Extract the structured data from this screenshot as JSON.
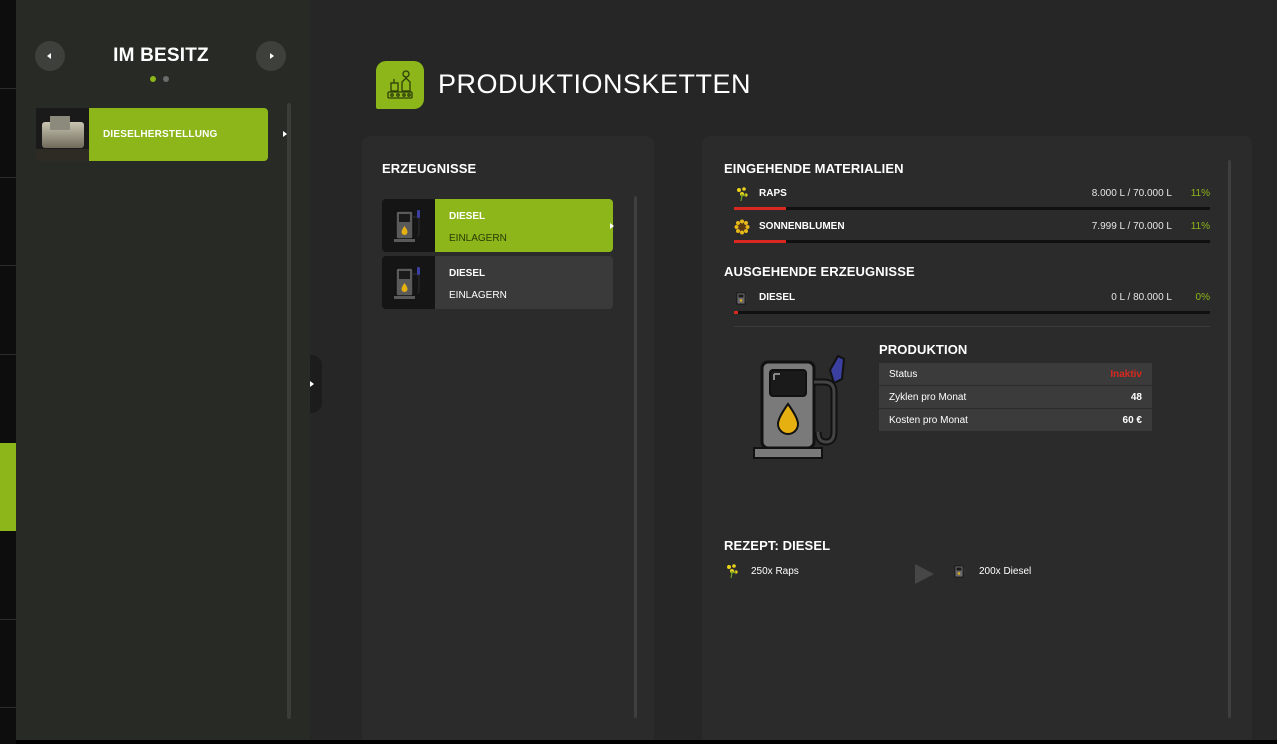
{
  "sidebar": {
    "title": "IM BESITZ",
    "page_dots": 2,
    "active_dot": 0,
    "items": [
      {
        "label": "DIESELHERSTELLUNG",
        "selected": true
      }
    ]
  },
  "main": {
    "title": "PRODUKTIONSKETTEN",
    "products_panel": {
      "heading": "ERZEUGNISSE",
      "items": [
        {
          "name": "DIESEL",
          "mode": "EINLAGERN",
          "selected": true
        },
        {
          "name": "DIESEL",
          "mode": "EINLAGERN",
          "selected": false
        }
      ]
    },
    "details": {
      "incoming_heading": "EINGEHENDE MATERIALIEN",
      "incoming": [
        {
          "name": "RAPS",
          "icon": "rapeseed-icon",
          "amount": "8.000 L / 70.000 L",
          "percent": "11%",
          "fill": 0.11
        },
        {
          "name": "SONNENBLUMEN",
          "icon": "sunflower-icon",
          "amount": "7.999 L / 70.000 L",
          "percent": "11%",
          "fill": 0.11
        }
      ],
      "outgoing_heading": "AUSGEHENDE ERZEUGNISSE",
      "outgoing": [
        {
          "name": "DIESEL",
          "icon": "fuel-pump-icon",
          "amount": "0 L / 80.000 L",
          "percent": "0%",
          "fill": 0.0
        }
      ],
      "production": {
        "heading": "PRODUKTION",
        "rows": [
          {
            "label": "Status",
            "value": "Inaktiv"
          },
          {
            "label": "Zyklen pro Monat",
            "value": "48"
          },
          {
            "label": "Kosten pro Monat",
            "value": "60 €"
          }
        ]
      },
      "recipe": {
        "heading": "REZEPT: DIESEL",
        "input": "250x Raps",
        "output": "200x Diesel"
      }
    }
  },
  "colors": {
    "accent": "#8cb61a",
    "alert": "#d8281f",
    "panel": "#2b2b2b",
    "background": "#262626"
  }
}
